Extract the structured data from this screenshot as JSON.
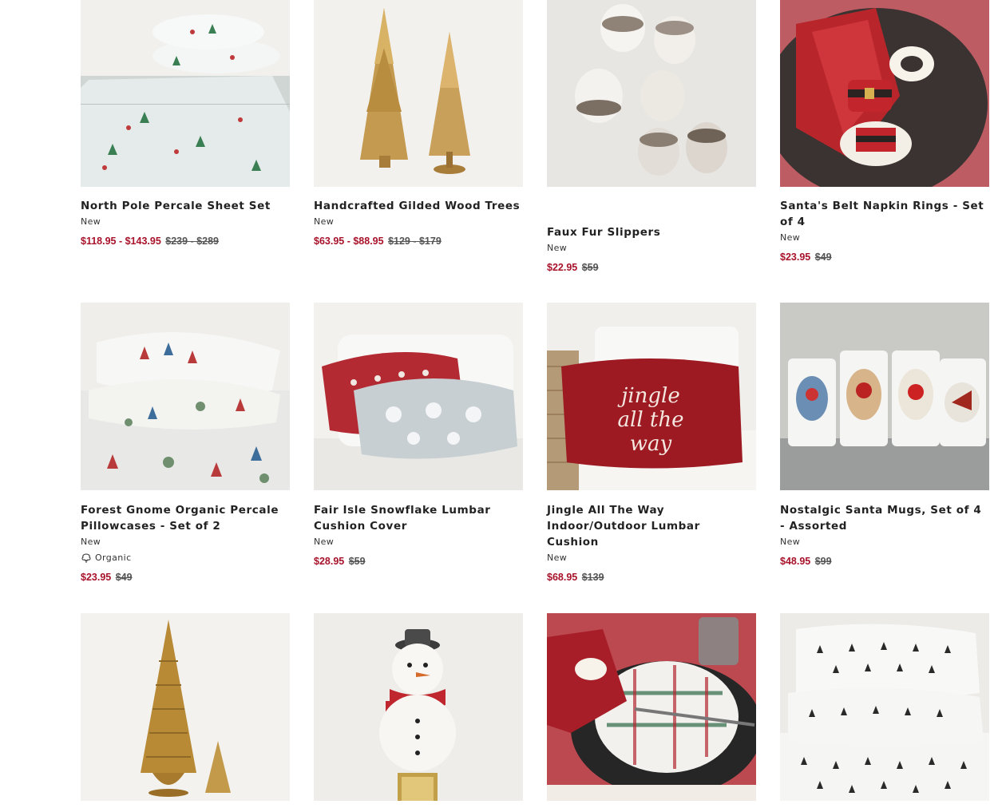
{
  "products": [
    {
      "title": "North Pole Percale Sheet Set",
      "badge": "New",
      "sale": "$118.95 - $143.95",
      "original": "$239 - $289",
      "image": "north-pole-sheet-set-image"
    },
    {
      "title": "Handcrafted Gilded Wood Trees",
      "badge": "New",
      "sale": "$63.95 - $88.95",
      "original": "$129 - $179",
      "image": "gilded-wood-trees-image"
    },
    {
      "title": "Faux Fur Slippers",
      "badge": "New",
      "sale": "$22.95",
      "original": "$59",
      "image": "faux-fur-slippers-image"
    },
    {
      "title": "Santa's Belt Napkin Rings - Set of 4",
      "badge": "New",
      "sale": "$23.95",
      "original": "$49",
      "image": "santa-napkin-rings-image"
    },
    {
      "title": "Forest Gnome Organic Percale Pillowcases - Set of 2",
      "badge": "New",
      "organic": "Organic",
      "sale": "$23.95",
      "original": "$49",
      "image": "gnome-pillowcases-image"
    },
    {
      "title": "Fair Isle Snowflake Lumbar Cushion Cover",
      "badge": "New",
      "sale": "$28.95",
      "original": "$59",
      "image": "fair-isle-cushion-image"
    },
    {
      "title": "Jingle All The Way Indoor/Outdoor Lumbar Cushion",
      "badge": "New",
      "sale": "$68.95",
      "original": "$139",
      "image": "jingle-cushion-image"
    },
    {
      "title": "Nostalgic Santa Mugs, Set of 4 - Assorted",
      "badge": "New",
      "sale": "$48.95",
      "original": "$99",
      "image": "santa-mugs-image"
    },
    {
      "image": "gold-trees-image"
    },
    {
      "image": "snowman-stopper-image"
    },
    {
      "image": "plaid-dinnerware-image"
    },
    {
      "image": "tree-print-sheets-image"
    }
  ],
  "colors": {
    "sale": "#a8122a",
    "text": "#222222",
    "muted": "#555555"
  }
}
